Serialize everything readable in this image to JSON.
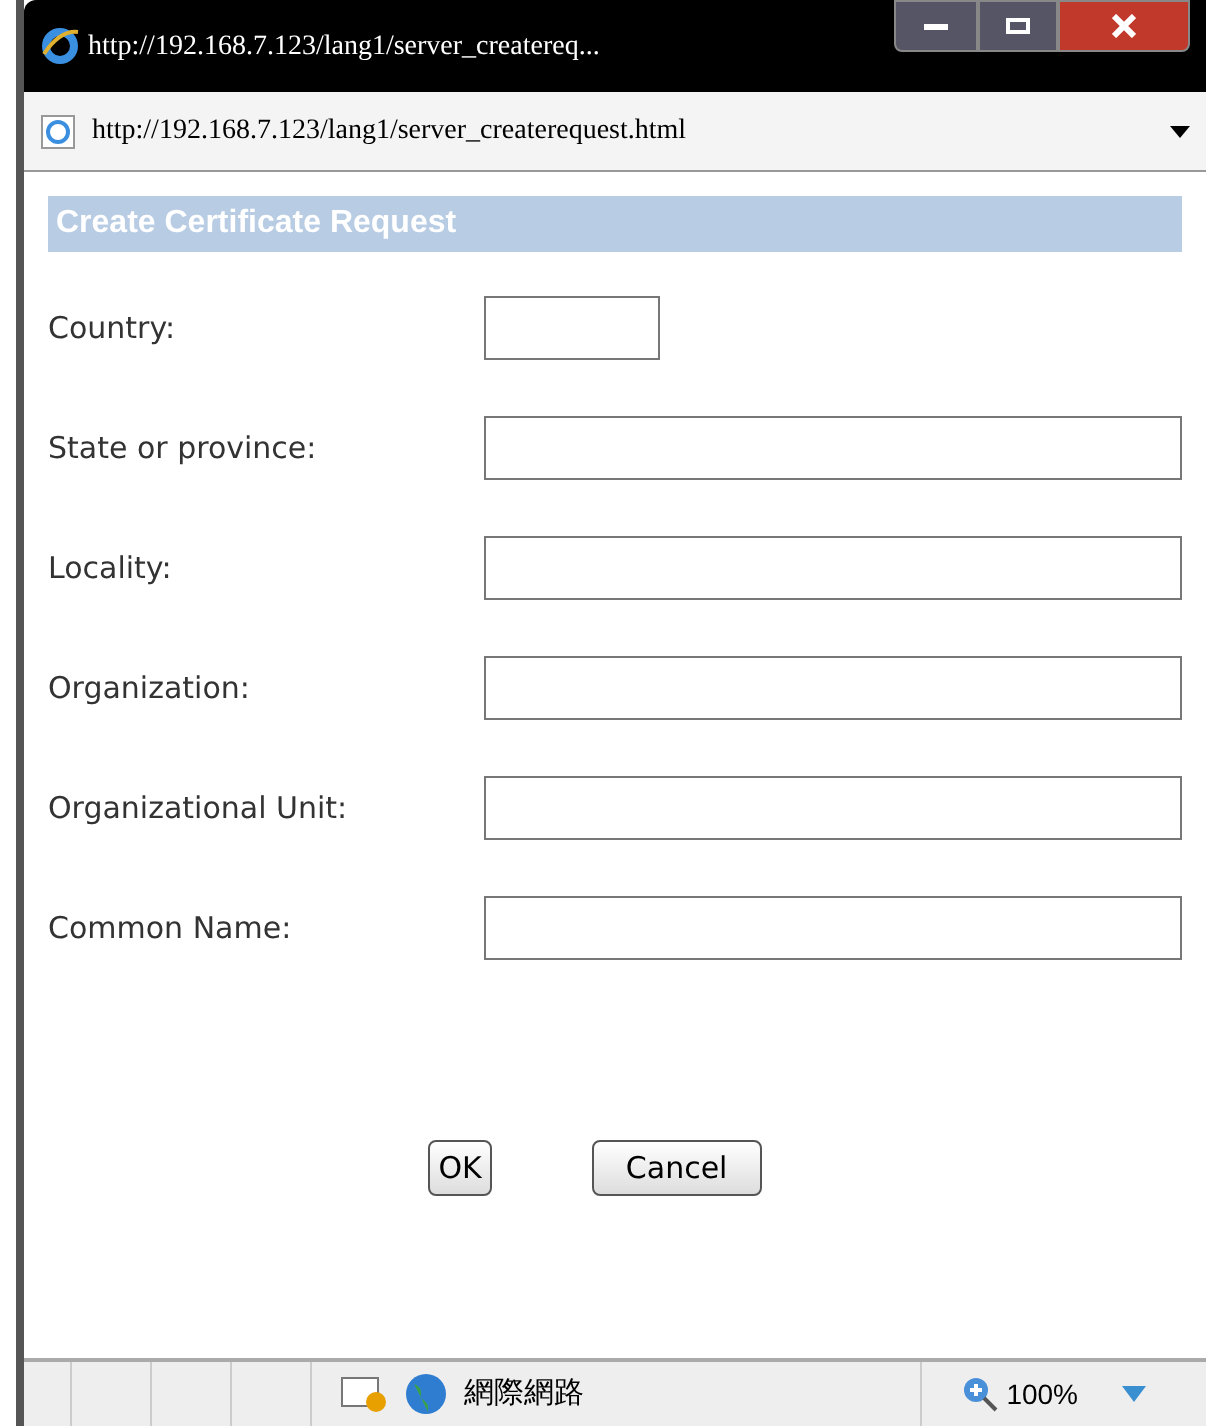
{
  "window": {
    "title": "http://192.168.7.123/lang1/server_createreq..."
  },
  "address_bar": {
    "value": "http://192.168.7.123/lang1/server_createrequest.html"
  },
  "form": {
    "heading": "Create Certificate Request",
    "fields": [
      {
        "label": "Country:",
        "kind": "short"
      },
      {
        "label": "State or province:",
        "kind": "wide"
      },
      {
        "label": "Locality:",
        "kind": "wide"
      },
      {
        "label": "Organization:",
        "kind": "wide"
      },
      {
        "label": "Organizational Unit:",
        "kind": "wide"
      },
      {
        "label": "Common Name:",
        "kind": "wide"
      }
    ],
    "buttons": [
      "OK",
      "Cancel"
    ]
  },
  "status_bar": {
    "zone": "網際網路",
    "zoom": "100%"
  }
}
